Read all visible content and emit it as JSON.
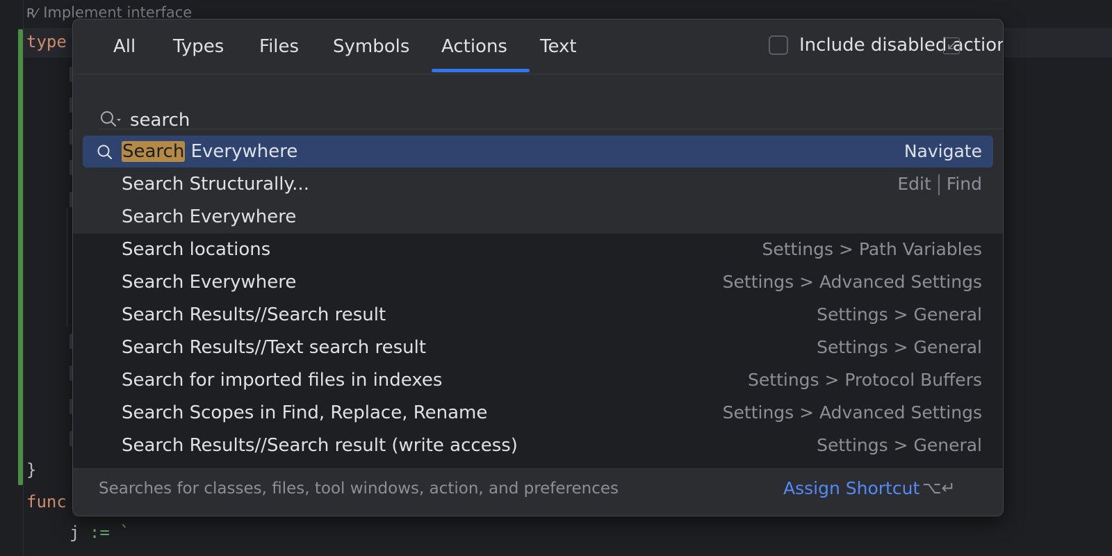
{
  "editor": {
    "hint_text": "Implement interface",
    "lines": [
      {
        "kw": "type",
        "rest": ""
      },
      {
        "kw": "}",
        "rest": ""
      },
      {
        "kw": "func",
        "rest": ""
      },
      {
        "kw": "j",
        "rest": " := `"
      }
    ]
  },
  "popup": {
    "tabs": [
      {
        "label": "All"
      },
      {
        "label": "Types"
      },
      {
        "label": "Files"
      },
      {
        "label": "Symbols"
      },
      {
        "label": "Actions"
      },
      {
        "label": "Text"
      }
    ],
    "active_tab": "Actions",
    "include_disabled_label": "Include disabled actions",
    "include_disabled_checked": false,
    "search_value": "search",
    "results": [
      {
        "prefix": "Search",
        "name": " Everywhere",
        "right": "Navigate",
        "selected": true
      },
      {
        "prefix": "",
        "name": "Search Structurally...",
        "right_left": "Edit",
        "right_right": "Find"
      },
      {
        "prefix": "",
        "name": "Search Everywhere",
        "right": ""
      },
      {
        "prefix": "",
        "name": "Search locations",
        "right": "Settings > Path Variables"
      },
      {
        "prefix": "",
        "name": "Search Everywhere",
        "right": "Settings > Advanced Settings"
      },
      {
        "prefix": "",
        "name": "Search Results//Search result",
        "right": "Settings > General"
      },
      {
        "prefix": "",
        "name": "Search Results//Text search result",
        "right": "Settings > General"
      },
      {
        "prefix": "",
        "name": "Search for imported files in indexes",
        "right": "Settings > Protocol Buffers"
      },
      {
        "prefix": "",
        "name": "Search Scopes in Find, Replace, Rename",
        "right": "Settings > Advanced Settings"
      },
      {
        "prefix": "",
        "name": "Search Results//Search result (write access)",
        "right": "Settings > General"
      }
    ],
    "footer": {
      "hint": "Searches for classes, files, tool windows, action, and preferences",
      "assign_label": "Assign Shortcut",
      "shortcut": "⌥↵"
    }
  },
  "colors": {
    "accent": "#3574f0",
    "selection": "#2e436e",
    "match_highlight": "#b48a44",
    "link": "#548af7",
    "keyword": "#cf8e6d",
    "string": "#6aab73"
  }
}
